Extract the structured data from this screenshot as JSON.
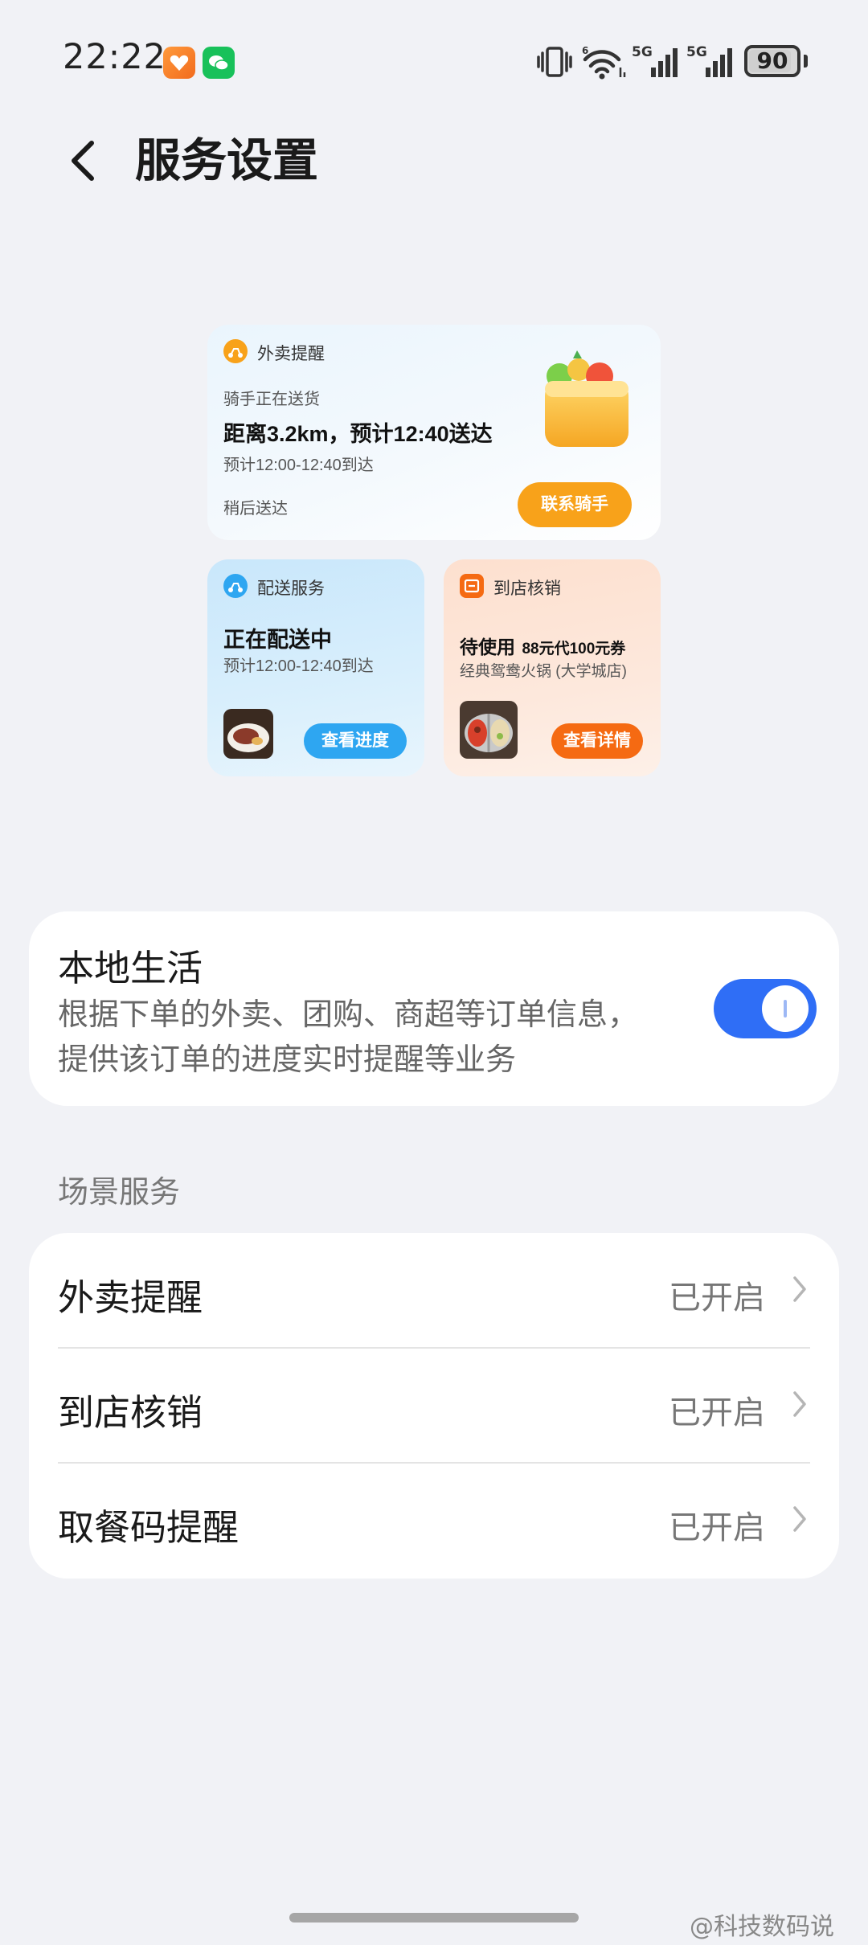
{
  "status_bar": {
    "time": "22:22",
    "battery": "90",
    "battery_level": 0.9,
    "network_1": "5G",
    "network_2": "5G"
  },
  "header": {
    "title": "服务设置"
  },
  "preview": {
    "delivery_card": {
      "header": "外卖提醒",
      "sub": "骑手正在送货",
      "main": "距离3.2km，预计12:40送达",
      "eta": "预计12:00-12:40到达",
      "later": "稍后送达",
      "button": "联系骑手",
      "accent": "#f8a21a"
    },
    "shipping_card": {
      "header": "配送服务",
      "main": "正在配送中",
      "eta": "预计12:00-12:40到达",
      "button": "查看进度",
      "accent": "#2ea6f1"
    },
    "store_card": {
      "header": "到店核销",
      "main_prefix": "待使用",
      "main_deal": "88元代100元券",
      "store": "经典鸳鸯火锅 (大学城店)",
      "button": "查看详情",
      "accent": "#f56a12"
    }
  },
  "local_life": {
    "title": "本地生活",
    "desc_line1": "根据下单的外卖、团购、商超等订单信息，",
    "desc_line2": "提供该订单的进度实时提醒等业务",
    "enabled": true,
    "toggle_color": "#2f6ef6"
  },
  "scenes": {
    "section_label": "场景服务",
    "items": [
      {
        "label": "外卖提醒",
        "status": "已开启"
      },
      {
        "label": "到店核销",
        "status": "已开启"
      },
      {
        "label": "取餐码提醒",
        "status": "已开启"
      }
    ]
  },
  "watermark": "@科技数码说"
}
